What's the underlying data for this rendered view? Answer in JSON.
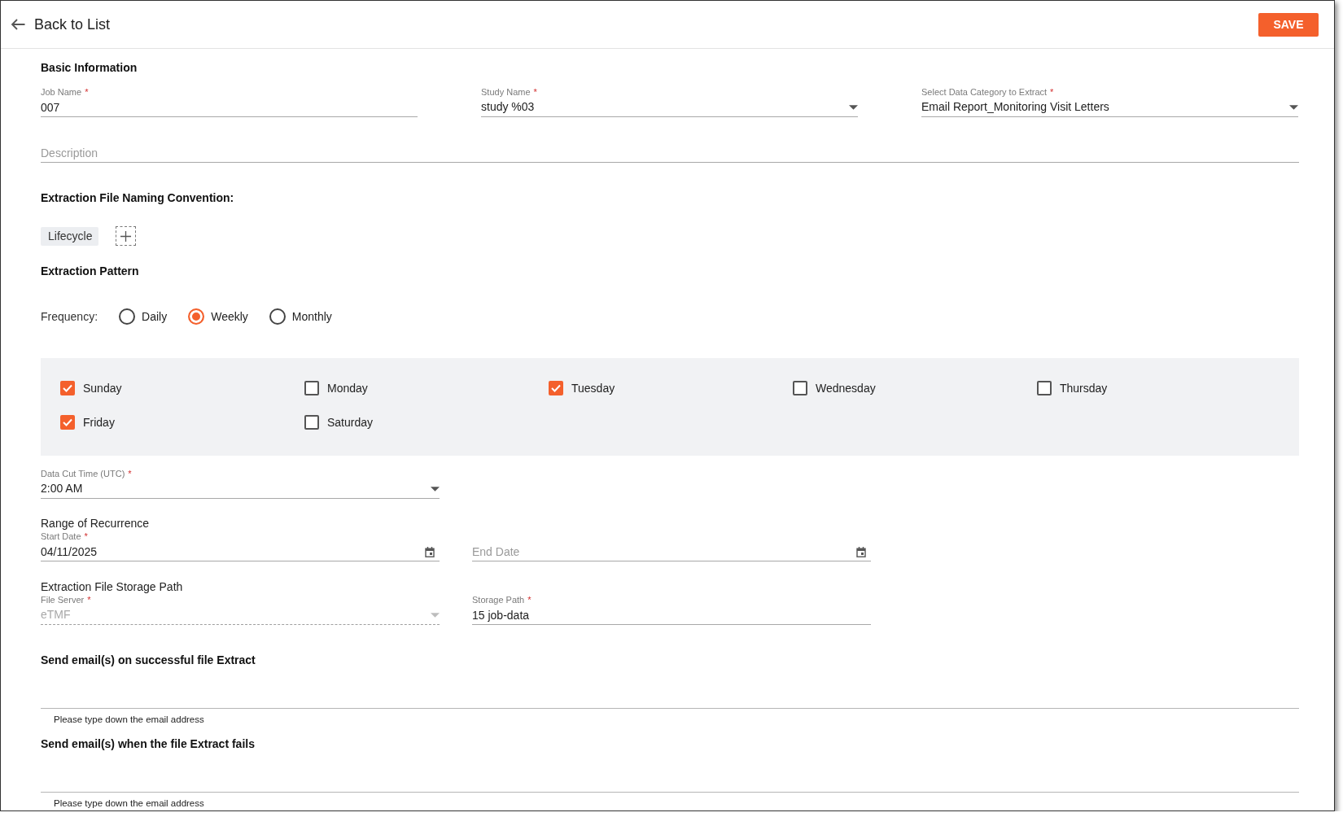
{
  "header": {
    "back_label": "Back to List",
    "save_label": "SAVE"
  },
  "basic_information": {
    "title": "Basic Information",
    "fields": [
      {
        "kind": "text",
        "label": "Job Name",
        "required_mark": "*",
        "value": "007"
      },
      {
        "kind": "select",
        "label": "Study Name",
        "required_mark": "*",
        "value": "study %03"
      },
      {
        "kind": "select",
        "label": "Select Data Category to Extract",
        "required_mark": "*",
        "value": "Email Report_Monitoring Visit Letters"
      }
    ],
    "description": {
      "placeholder": "Description"
    }
  },
  "naming_convention": {
    "title": "Extraction File Naming Convention:",
    "chips": [
      "Lifecycle"
    ]
  },
  "extraction_pattern": {
    "title": "Extraction Pattern",
    "frequency": {
      "label": "Frequency:",
      "options": [
        {
          "label": "Daily",
          "selected": false
        },
        {
          "label": "Weekly",
          "selected": true
        },
        {
          "label": "Monthly",
          "selected": false
        }
      ]
    },
    "days": [
      {
        "label": "Sunday",
        "checked": true
      },
      {
        "label": "Monday",
        "checked": false
      },
      {
        "label": "Tuesday",
        "checked": true
      },
      {
        "label": "Wednesday",
        "checked": false
      },
      {
        "label": "Thursday",
        "checked": false
      },
      {
        "label": "Friday",
        "checked": true
      },
      {
        "label": "Saturday",
        "checked": false
      }
    ],
    "cut_time": {
      "kind": "select",
      "label": "Data Cut Time (UTC)",
      "required_mark": "*",
      "value": "2:00 AM"
    }
  },
  "range_of_recurrence": {
    "title": "Range of Recurrence",
    "fields": [
      {
        "kind": "date",
        "label": "Start Date",
        "required_mark": "*",
        "value": "04/11/2025"
      },
      {
        "kind": "date",
        "placeholder": "End Date"
      }
    ]
  },
  "storage_path": {
    "title": "Extraction File Storage Path",
    "fields": [
      {
        "kind": "select",
        "label": "File Server",
        "required_mark": "*",
        "value": "eTMF",
        "disabled": true
      },
      {
        "kind": "text",
        "label": "Storage Path",
        "required_mark": "*",
        "value": "15 job-data",
        "disabled": false
      }
    ]
  },
  "email_sections": [
    {
      "title": "Send email(s) on successful file Extract",
      "hint": "Please type down the email address"
    },
    {
      "title": "Send email(s) when the file Extract fails",
      "hint": "Please type down the email address"
    }
  ]
}
